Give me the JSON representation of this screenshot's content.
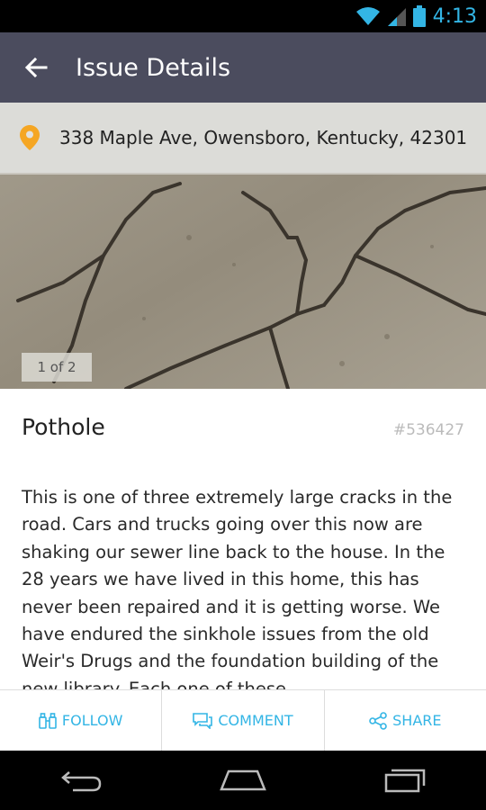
{
  "status_bar": {
    "time": "4:13"
  },
  "app_bar": {
    "title": "Issue Details"
  },
  "photo": {
    "address": "338  Maple Ave, Owensboro, Kentucky, 42301",
    "counter": "1 of 2"
  },
  "issue": {
    "title": "Pothole",
    "id": "#536427",
    "description": "This is one of three extremely large cracks in the road. Cars and trucks going over this now are shaking our sewer line back to the house. In the 28 years we have lived in this home, this has never been repaired and it is getting worse. We have endured the sinkhole issues from the old Weir's Drugs and the foundation building of the new library. Each one of these"
  },
  "actions": {
    "follow": "FOLLOW",
    "comment": "COMMENT",
    "share": "SHARE"
  },
  "colors": {
    "accent": "#33b5e5",
    "app_bar": "#4b4c5e",
    "pin": "#f5a623"
  }
}
